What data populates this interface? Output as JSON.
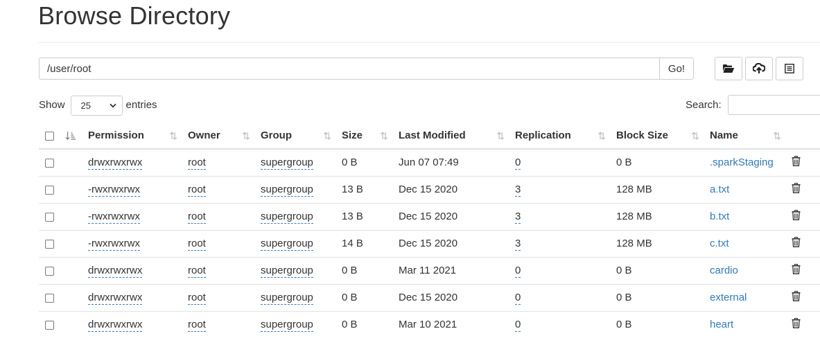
{
  "page": {
    "title": "Browse Directory"
  },
  "path_bar": {
    "path_value": "/user/root",
    "go_label": "Go!"
  },
  "toolbar": {
    "buttons": [
      {
        "name": "create-directory-button",
        "icon": "folder-open-icon"
      },
      {
        "name": "upload-button",
        "icon": "cloud-upload-icon"
      },
      {
        "name": "cut-paste-button",
        "icon": "list-icon"
      }
    ]
  },
  "entries_control": {
    "show_label": "Show",
    "selected_value": "25",
    "entries_label": "entries"
  },
  "search": {
    "label": "Search:",
    "value": ""
  },
  "table": {
    "columns": [
      "Permission",
      "Owner",
      "Group",
      "Size",
      "Last Modified",
      "Replication",
      "Block Size",
      "Name"
    ],
    "rows": [
      {
        "permission": "drwxrwxrwx",
        "owner": "root",
        "group": "supergroup",
        "size": "0 B",
        "last_modified": "Jun 07 07:49",
        "replication": "0",
        "block_size": "0 B",
        "name": ".sparkStaging"
      },
      {
        "permission": "-rwxrwxrwx",
        "owner": "root",
        "group": "supergroup",
        "size": "13 B",
        "last_modified": "Dec 15 2020",
        "replication": "3",
        "block_size": "128 MB",
        "name": "a.txt"
      },
      {
        "permission": "-rwxrwxrwx",
        "owner": "root",
        "group": "supergroup",
        "size": "13 B",
        "last_modified": "Dec 15 2020",
        "replication": "3",
        "block_size": "128 MB",
        "name": "b.txt"
      },
      {
        "permission": "-rwxrwxrwx",
        "owner": "root",
        "group": "supergroup",
        "size": "14 B",
        "last_modified": "Dec 15 2020",
        "replication": "3",
        "block_size": "128 MB",
        "name": "c.txt"
      },
      {
        "permission": "drwxrwxrwx",
        "owner": "root",
        "group": "supergroup",
        "size": "0 B",
        "last_modified": "Mar 11 2021",
        "replication": "0",
        "block_size": "0 B",
        "name": "cardio"
      },
      {
        "permission": "drwxrwxrwx",
        "owner": "root",
        "group": "supergroup",
        "size": "0 B",
        "last_modified": "Dec 15 2020",
        "replication": "0",
        "block_size": "0 B",
        "name": "external"
      },
      {
        "permission": "drwxrwxrwx",
        "owner": "root",
        "group": "supergroup",
        "size": "0 B",
        "last_modified": "Mar 10 2021",
        "replication": "0",
        "block_size": "0 B",
        "name": "heart"
      }
    ]
  },
  "colors": {
    "link": "#337ab7",
    "border": "#dee2e6",
    "text": "#333333"
  }
}
